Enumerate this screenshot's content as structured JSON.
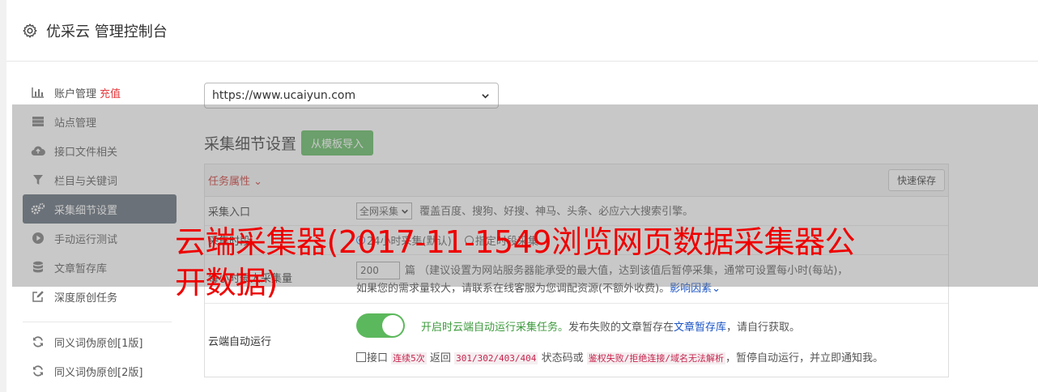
{
  "header": {
    "title": "优采云 管理控制台",
    "icon": "gear-icon"
  },
  "sidebar": {
    "items": [
      {
        "label": "账户管理",
        "badge": "充值",
        "icon": "bar-chart-icon"
      },
      {
        "label": "站点管理",
        "icon": "server-icon"
      },
      {
        "label": "接口文件相关",
        "icon": "cloud-upload-icon"
      },
      {
        "label": "栏目与关键词",
        "icon": "filter-icon"
      },
      {
        "label": "采集细节设置",
        "icon": "cogs-icon",
        "active": true
      },
      {
        "label": "手动运行测试",
        "icon": "play-circle-icon"
      },
      {
        "label": "文章暂存库",
        "icon": "database-icon"
      },
      {
        "label": "深度原创任务",
        "icon": "edit-icon"
      },
      {
        "label": "同义词伪原创[1版]",
        "icon": "refresh-icon"
      },
      {
        "label": "同义词伪原创[2版]",
        "icon": "refresh-icon"
      }
    ]
  },
  "main": {
    "site_select": "https://www.ucaiyun.com",
    "section_title": "采集细节设置",
    "import_button": "从模板导入",
    "task_attr": "任务属性 ⌄",
    "save_button": "快速保存",
    "rows": {
      "entry": {
        "label": "采集入口",
        "select": "全网采集",
        "desc": "覆盖百度、搜狗、好搜、神马、头条、必应六大搜索引擎。"
      },
      "period": {
        "label": "采集时段",
        "option1": "24小时采集(默认)",
        "option2": "指定时段采集"
      },
      "max": {
        "label": "每小时最大采集量",
        "value": "200",
        "desc": "篇 （建议设置为网站服务器能承受的最大值，达到该值后暂停采集，通常可设置每小时(每站)，",
        "desc2": "如果您的需求量较大，请联系在线客服为您调配资源(不额外收费)。",
        "link": "影响因素⌄"
      },
      "auto": {
        "label": "云端自动运行",
        "line1_green": "开启时云端自动运行采集任务。",
        "line1_rest": "发布失败的文章暂存在",
        "line1_link": "文章暂存库",
        "line1_end": "，请自行获取。",
        "chk_label": "接口",
        "code1": "连续5次",
        "t2": "返回",
        "code2": "301/302/403/404",
        "t3": "状态码或",
        "code3": "鉴权失败/拒绝连接/域名无法解析",
        "t4": "，暂停自动运行，并立即通知我。"
      }
    }
  },
  "banner": "云端采集器(2017-11-1549浏览网页数据采集器公开数据)"
}
